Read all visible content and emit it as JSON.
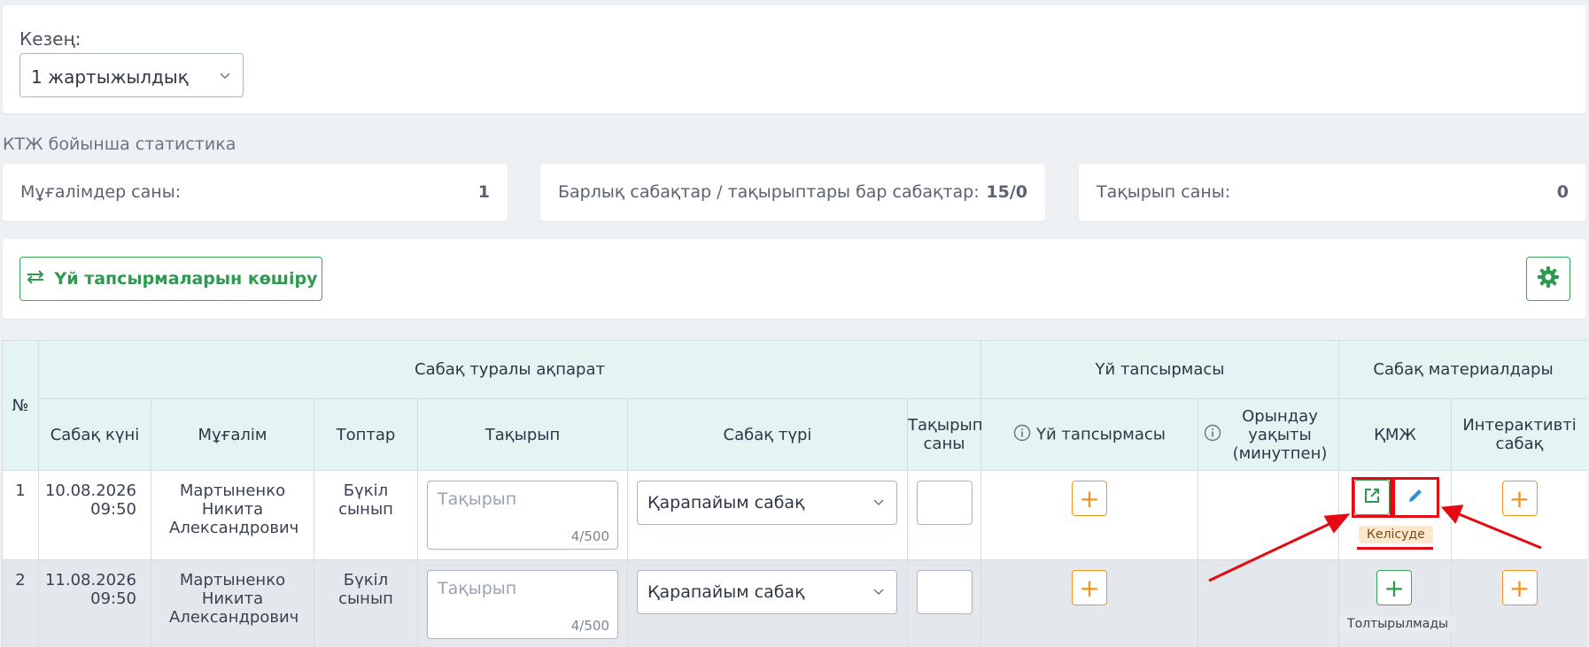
{
  "period": {
    "label": "Кезең:",
    "selected": "1 жартыжылдық"
  },
  "stats": {
    "title": "КТЖ бойынша статистика",
    "teachers_label": "Мұғалімдер саны:",
    "teachers_value": "1",
    "lessons_label": "Барлық сабақтар / тақырыптары бар сабақтар:",
    "lessons_value": "15/0",
    "topics_label": "Тақырып саны:",
    "topics_value": "0"
  },
  "toolbar": {
    "copy_label": "Үй тапсырмаларын көшіру",
    "settings_icon": "gear-icon"
  },
  "table": {
    "group_headers": {
      "number": "№",
      "lesson_info": "Сабақ туралы ақпарат",
      "homework": "Үй тапсырмасы",
      "materials": "Сабақ материалдары"
    },
    "columns": {
      "date": "Сабақ күні",
      "teacher": "Мұғалім",
      "groups": "Топтар",
      "topic": "Тақырып",
      "lesson_type": "Сабақ түрі",
      "topic_count": "Тақырып саны",
      "homework": "Үй тапсырмасы",
      "duration": "Орындау уақыты (минутпен)",
      "kmzh": "ҚМЖ",
      "interactive": "Интерактивті сабақ"
    },
    "rows": [
      {
        "num": "1",
        "date": "10.08.2026",
        "time": "09:50",
        "teacher": "Мартыненко Никита Александрович",
        "groups": "Бүкіл сынып",
        "topic_placeholder": "Тақырып",
        "topic_counter": "4/500",
        "lesson_type": "Қарапайым сабақ",
        "kmzh_status": "Келісуде"
      },
      {
        "num": "2",
        "date": "11.08.2026",
        "time": "09:50",
        "teacher": "Мартыненко Никита Александрович",
        "groups": "Бүкіл сынып",
        "topic_placeholder": "Тақырып",
        "topic_counter": "4/500",
        "lesson_type": "Қарапайым сабақ",
        "kmzh_status": "Толтырылмады"
      }
    ]
  },
  "colors": {
    "accent_green": "#3aa757",
    "accent_orange": "#f39221",
    "edit_blue": "#2b8fd6",
    "annotation_red": "#e50914",
    "header_bg": "#e3f4f3"
  }
}
